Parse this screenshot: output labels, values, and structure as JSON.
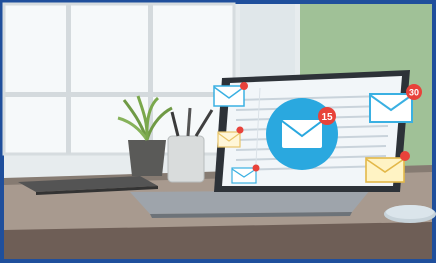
{
  "scene": {
    "border_color": "#1f4f9c",
    "wall_color": "#e9eef0",
    "window_light": "#f7fafb",
    "green_wall": "#8fb888",
    "desk_color": "#a6968a",
    "desk_edge": "#6b5a52",
    "laptop_body": "#bfc5cc",
    "screen_bg": "#f4f7fa",
    "accent_blue": "#29a9e0",
    "badge_red": "#e8423a"
  },
  "badges": {
    "center": "15",
    "right_top": "30"
  }
}
